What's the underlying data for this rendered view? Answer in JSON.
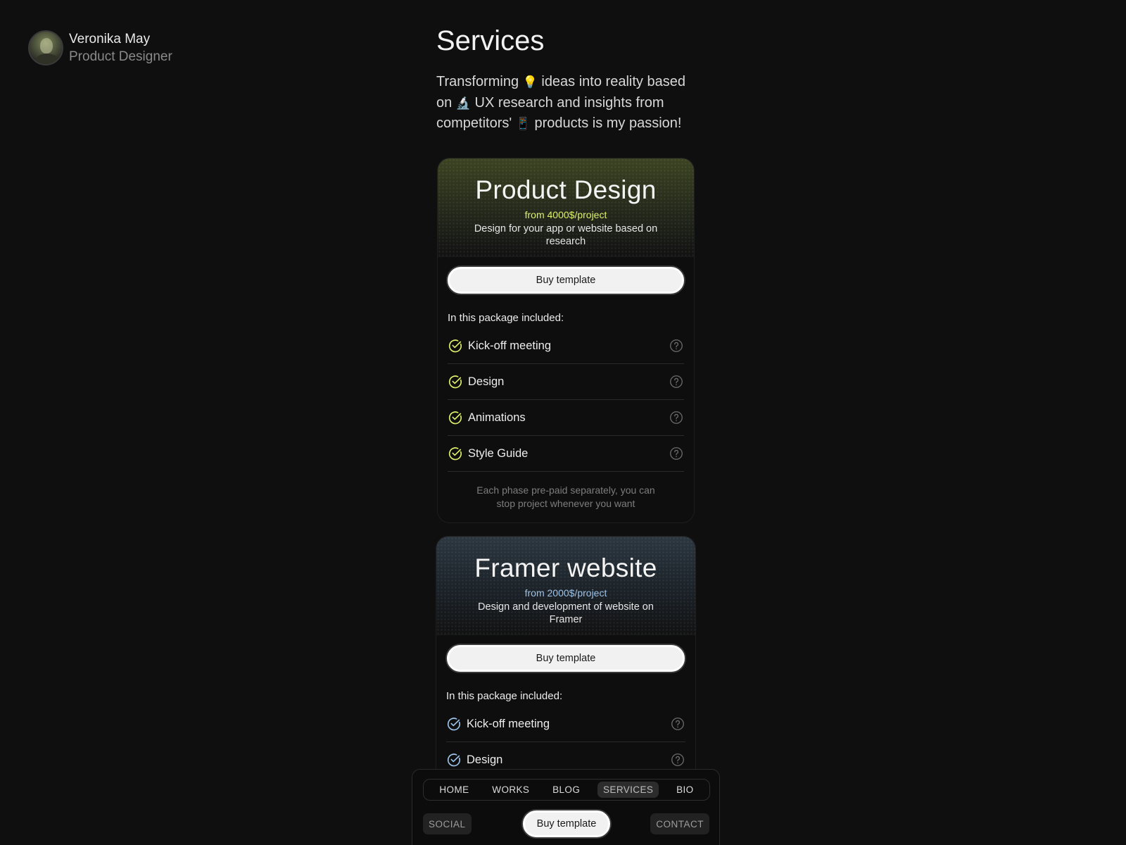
{
  "profile": {
    "name": "Veronika May",
    "role": "Product Designer"
  },
  "page": {
    "title": "Services",
    "intro": {
      "part1": "Transforming ",
      "emoji1": "💡",
      "part2": " ideas into reality based on ",
      "emoji2": "🔬",
      "part3": " UX research and insights from competitors' ",
      "emoji3": "📱",
      "part4": " products is my passion!"
    }
  },
  "cards": [
    {
      "title": "Product Design",
      "price": "from 4000$/project",
      "description": "Design for your app or website based on research",
      "button": "Buy template",
      "included_title": "In this package included:",
      "features": [
        "Kick-off meeting",
        "Design",
        "Animations",
        "Style Guide"
      ],
      "note": "Each phase pre-paid separately, you can stop project whenever you want",
      "accent": "#dff06a"
    },
    {
      "title": "Framer website",
      "price": "from 2000$/project",
      "description": "Design and development of website on Framer",
      "button": "Buy template",
      "included_title": "In this package included:",
      "features": [
        "Kick-off meeting",
        "Design"
      ],
      "accent": "#9ec3e8"
    }
  ],
  "bottom_nav": {
    "tabs": [
      "HOME",
      "WORKS",
      "BLOG",
      "SERVICES",
      "BIO"
    ],
    "active_tab": "SERVICES",
    "social": "SOCIAL",
    "buy": "Buy template",
    "contact": "CONTACT"
  }
}
